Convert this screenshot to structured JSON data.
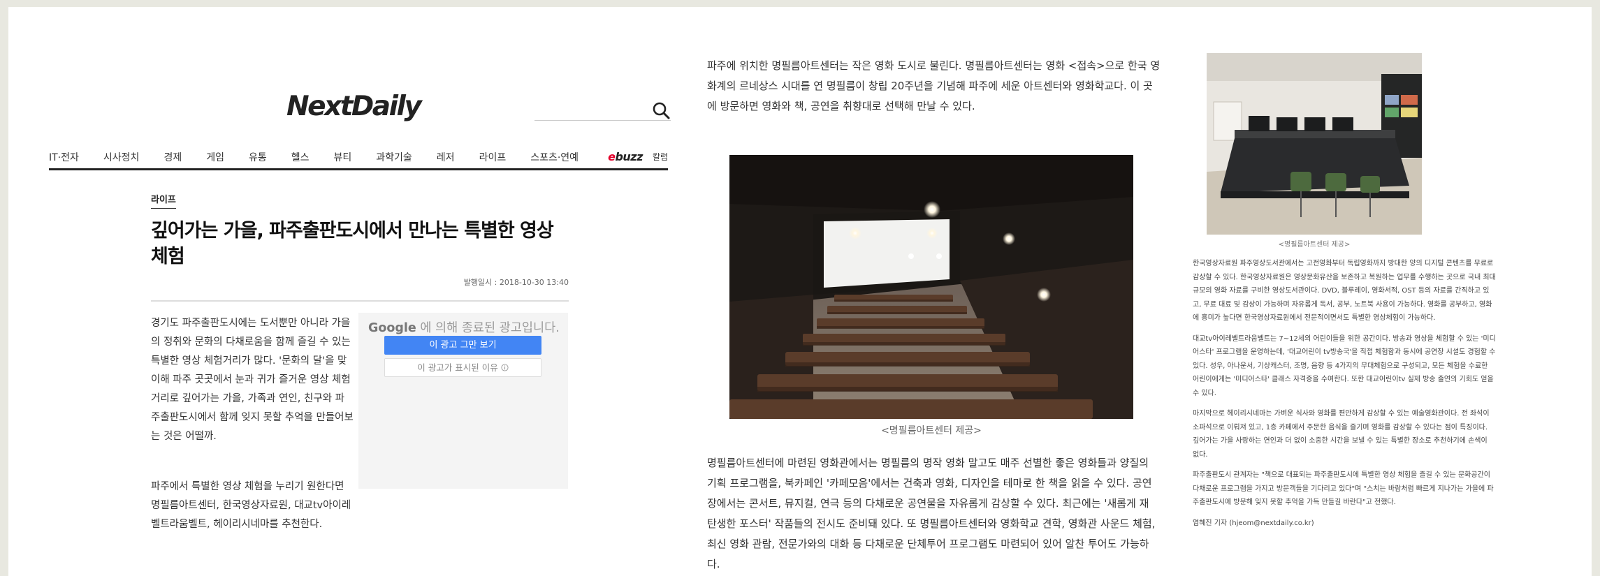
{
  "site": {
    "logo": "NextDaily"
  },
  "nav": {
    "items": [
      "IT·전자",
      "시사정치",
      "경제",
      "게임",
      "유통",
      "헬스",
      "뷰티",
      "과학기술",
      "레저",
      "라이프",
      "스포츠·연예"
    ],
    "ebuzz_e": "e",
    "ebuzz_rest": "buzz",
    "column": "칼럼"
  },
  "article": {
    "section": "라이프",
    "title": "깊어가는 가을, 파주출판도시에서 만나는 특별한 영상 체험",
    "date": "발행일시 : 2018-10-30 13:40",
    "p1": "경기도 파주출판도시에는 도서뿐만 아니라 가을의 정취와 문화의 다채로움을 함께 즐길 수 있는 특별한 영상 체험거리가 많다. '문화의 달'을 맞이해 파주 곳곳에서 눈과 귀가 즐거운 영상 체험거리로 깊어가는 가을, 가족과 연인, 친구와 파주출판도시에서 함께 잊지 못할 추억을 만들어보는 것은 어떨까.",
    "p2": "파주에서 특별한 영상 체험을 누리기 원한다면 명필름아트센터, 한국영상자료원, 대교tv아이레벨트라움벨트, 헤이리시네마를 추천한다.",
    "col2_intro": "파주에 위치한 명필름아트센터는 작은 영화 도시로 불린다. 명필름아트센터는 영화 <접속>으로 한국 영화계의 르네상스 시대를 연 명필름이 창립 20주년을 기념해 파주에 세운 아트센터와 영화학교다. 이 곳에 방문하면 영화와 책, 공연을 취향대로 선택해 만날 수 있다.",
    "caption_theater": "<명필름아트센터 제공>",
    "col2_body": "명필름아트센터에 마련된 영화관에서는 명필름의 명작 영화 말고도 매주 선별한 좋은 영화들과 양질의 기획 프로그램을, 북카페인 '카페모음'에서는 건축과 영화, 디자인을 테마로 한 책을 읽을 수 있다. 공연장에서는 콘서트, 뮤지컬, 연극 등의 다채로운 공연물을 자유롭게 감상할 수 있다. 최근에는 '새롭게 재 탄생한 포스터' 작품들의 전시도 준비돼 있다. 또 명필름아트센터와 영화학교 견학, 영화관 사운드 체험, 최신 영화 관람, 전문가와의 대화 등 다채로운 단체투어 프로그램도 마련되어 있어 알찬 투어도 가능하다.",
    "caption_studio": "<명필름아트센터 제공>",
    "col3_p1": "한국영상자료원 파주영상도서관에서는 고전영화부터 독립영화까지 방대한 양의 디지털 콘텐츠를 무료로 감상할 수 있다. 한국영상자료원은 영상문화유산을 보존하고 복원하는 업무를 수행하는 곳으로 국내 최대 규모의 영화 자료를 구비한 영상도서관이다. DVD, 블루레이, 영화서적, OST 등의 자료를 간직하고 있고, 무료 대료 및 감상이 가능하며 자유롭게 독서, 공부, 노트북 사용이 가능하다. 영화를 공부하고, 영화에 흥미가 높다면 한국영상자료원에서 전문적이면서도 특별한 영상체험이 가능하다.",
    "col3_p2": "대교tv아이레벨트라움벨트는 7~12세의 어린이들을 위한 공간이다. 방송과 영상을 체험할 수 있는 '미디어스타' 프로그램을 운영하는데, '대교어린이 tv방송국'을 직접 체험함과 동시에 공연장 시설도 경험할 수 있다. 성우, 아나운서, 기상캐스터, 조명, 음향 등 4가지의 무대체험으로 구성되고, 모든 체험을 수료한 어린이에게는 '미디어스타' 클래스 자격증을 수여한다. 또한 대교어린이tv 실제 방송 출연의 기회도 얻을 수 있다.",
    "col3_p3": "마지막으로 헤이리시네마는 가벼운 식사와 영화를 편안하게 감상할 수 있는 예술영화관이다. 전 좌석이 소파석으로 이뤄져 있고, 1층 카페에서 주문한 음식을 즐기며 영화를 감상할 수 있다는 점이 특징이다. 깊어가는 가을 사랑하는 연인과 더 없이 소중한 시간을 보낼 수 있는 특별한 장소로 추천하기에 손색이 없다.",
    "col3_p4": "파주출판도시 관계자는 \"책으로 대표되는 파주출판도시에 특별한 영상 체험을 즐길 수 있는 문화공간이 다채로운 프로그램을 가지고 방문객들을 기다리고 있다\"며 \"스치는 바람처럼 빠르게 지나가는 가을에 파주출판도시에 방문해 잊지 못할 추억을 가득 만들길 바란다\"고 전했다.",
    "byline": "염혜진 기자 (hjeom@nextdaily.co.kr)"
  },
  "ad": {
    "google": "Google",
    "closed_text": "에 의해 종료된 광고입니다.",
    "stop_button": "이 광고 그만 보기",
    "why_button": "이 광고가 표시된 이유",
    "info_icon": "info-icon"
  },
  "icons": {
    "search": "search-icon"
  },
  "colors": {
    "ebuzz_red": "#e4002b",
    "ad_button_blue": "#4285f4",
    "nav_rule": "#222222"
  }
}
